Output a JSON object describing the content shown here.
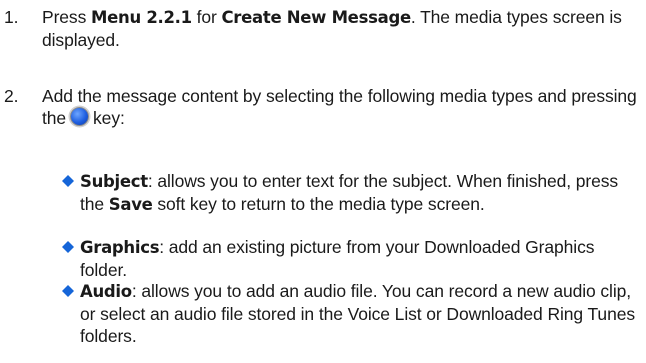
{
  "steps": [
    {
      "number": "1.",
      "pre": "Press ",
      "bold1": "Menu 2.2.1",
      "mid": " for ",
      "bold2": "Create New Message",
      "post": ". The media types screen is displayed."
    },
    {
      "number": "2.",
      "pre": "Add the message content by selecting the following media types and pressing the",
      "key_icon": "ok-key-icon",
      "post": "key:"
    }
  ],
  "bullets": [
    {
      "title": "Subject",
      "pre": ": allows you to enter text for the subject. When finished, press the ",
      "bold": "Save",
      "post": " soft key to return to the media type screen."
    },
    {
      "title": "Graphics",
      "text": ": add an existing picture from your Downloaded Graphics folder."
    },
    {
      "title": "Audio",
      "text": ": allows you to add an audio file. You can record a new audio clip, or select an audio file stored in the Voice List or Downloaded Ring Tunes folders."
    }
  ],
  "colors": {
    "bullet": "#1565d8",
    "text": "#1a1a1a",
    "ok_key": "#1f5fe0"
  }
}
